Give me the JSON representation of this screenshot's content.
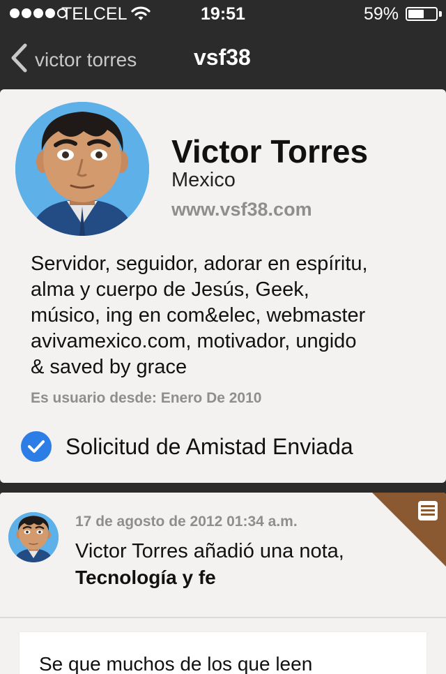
{
  "status_bar": {
    "carrier": "TELCEL",
    "time": "19:51",
    "battery_percent_label": "59%",
    "battery_level": 0.59,
    "signal_bars_filled": 4,
    "signal_bars_total": 5
  },
  "nav": {
    "back_label": "victor torres",
    "title": "vsf38"
  },
  "profile": {
    "name": "Victor Torres",
    "location": "Mexico",
    "website": "www.vsf38.com",
    "bio_lines": [
      "Servidor, seguidor, adorar en espíritu,",
      "alma y cuerpo de Jesús, Geek,",
      "músico, ing en com&elec, webmaster",
      "avivamexico.com, motivador, ungido",
      "& saved by grace"
    ],
    "member_since": "Es usuario desde: Enero De 2010",
    "friend_status": "Solicitud de Amistad Enviada"
  },
  "feed_item": {
    "date": "17 de agosto de 2012 01:34 a.m.",
    "action": "Victor Torres añadió una nota,",
    "title": "Tecnología y fe",
    "preview": "Se que muchos de los que leen"
  },
  "colors": {
    "background": "#2b2b2b",
    "card": "#f3f2f0",
    "accent_blue": "#2c7de6",
    "ribbon_brown": "#8a5932",
    "muted_text": "#8e8e8e"
  },
  "icons": {
    "back": "chevron-left-icon",
    "friend_status": "checkmark-icon",
    "note": "note-lines-icon",
    "wifi": "wifi-icon",
    "battery": "battery-icon"
  }
}
